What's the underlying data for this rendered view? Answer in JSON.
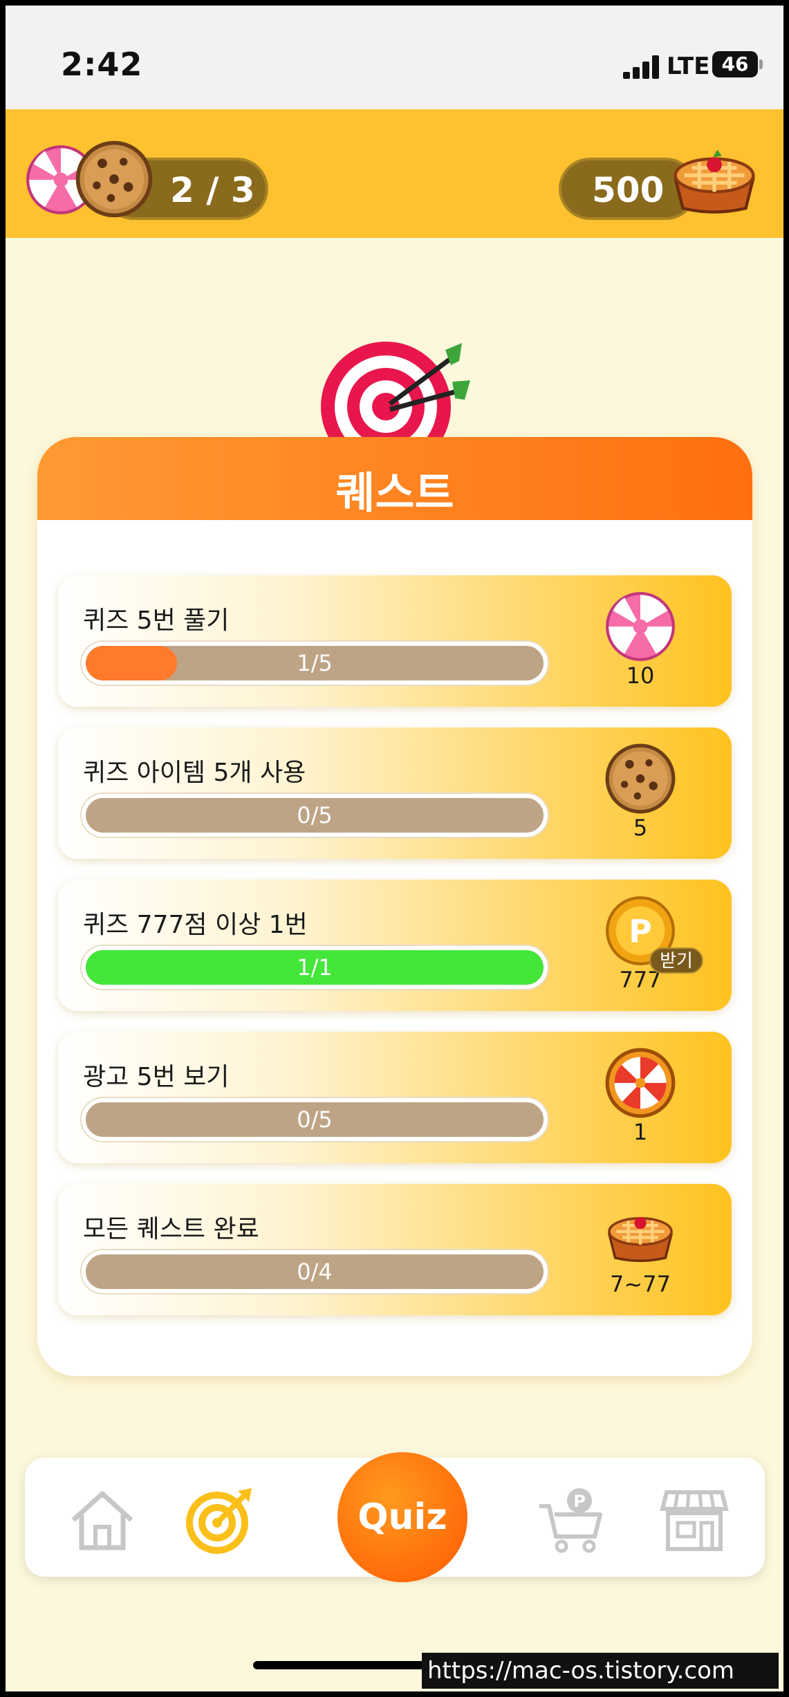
{
  "status_bar": {
    "time": "2:42",
    "network": "LTE",
    "battery": "46"
  },
  "header": {
    "lives_text": "2 / 3",
    "pie_count": "500"
  },
  "quest": {
    "title": "퀘스트",
    "items": [
      {
        "label": "퀴즈 5번 풀기",
        "progress_text": "1/5",
        "progress": 0.2,
        "fill_color": "#ff7a2a",
        "reward_icon": "candy-icon",
        "reward_value": "10",
        "claimable": false
      },
      {
        "label": "퀴즈 아이템 5개 사용",
        "progress_text": "0/5",
        "progress": 0.0,
        "fill_color": "#ff7a2a",
        "reward_icon": "cookie-icon",
        "reward_value": "5",
        "claimable": false
      },
      {
        "label": "퀴즈 777점 이상 1번",
        "progress_text": "1/1",
        "progress": 1.0,
        "fill_color": "#44e63a",
        "reward_icon": "point-coin-icon",
        "reward_value": "777",
        "claimable": true,
        "claim_label": "받기"
      },
      {
        "label": "광고 5번 보기",
        "progress_text": "0/5",
        "progress": 0.0,
        "fill_color": "#ff7a2a",
        "reward_icon": "roulette-icon",
        "reward_value": "1",
        "claimable": false
      },
      {
        "label": "모든 퀘스트 완료",
        "progress_text": "0/4",
        "progress": 0.0,
        "fill_color": "#ff7a2a",
        "reward_icon": "pie-icon",
        "reward_value": "7~77",
        "claimable": false
      }
    ]
  },
  "bottom_nav": {
    "quiz_label": "Quiz",
    "items": [
      "home-icon",
      "target-icon",
      "quiz-button",
      "point-shop-cart-icon",
      "store-icon"
    ],
    "active": "target-icon"
  },
  "watermark": "https://mac-os.tistory.com",
  "colors": {
    "header": "#fec12f",
    "background": "#fdf8dc",
    "accent": "#ff6f0f",
    "track": "#bea486"
  }
}
